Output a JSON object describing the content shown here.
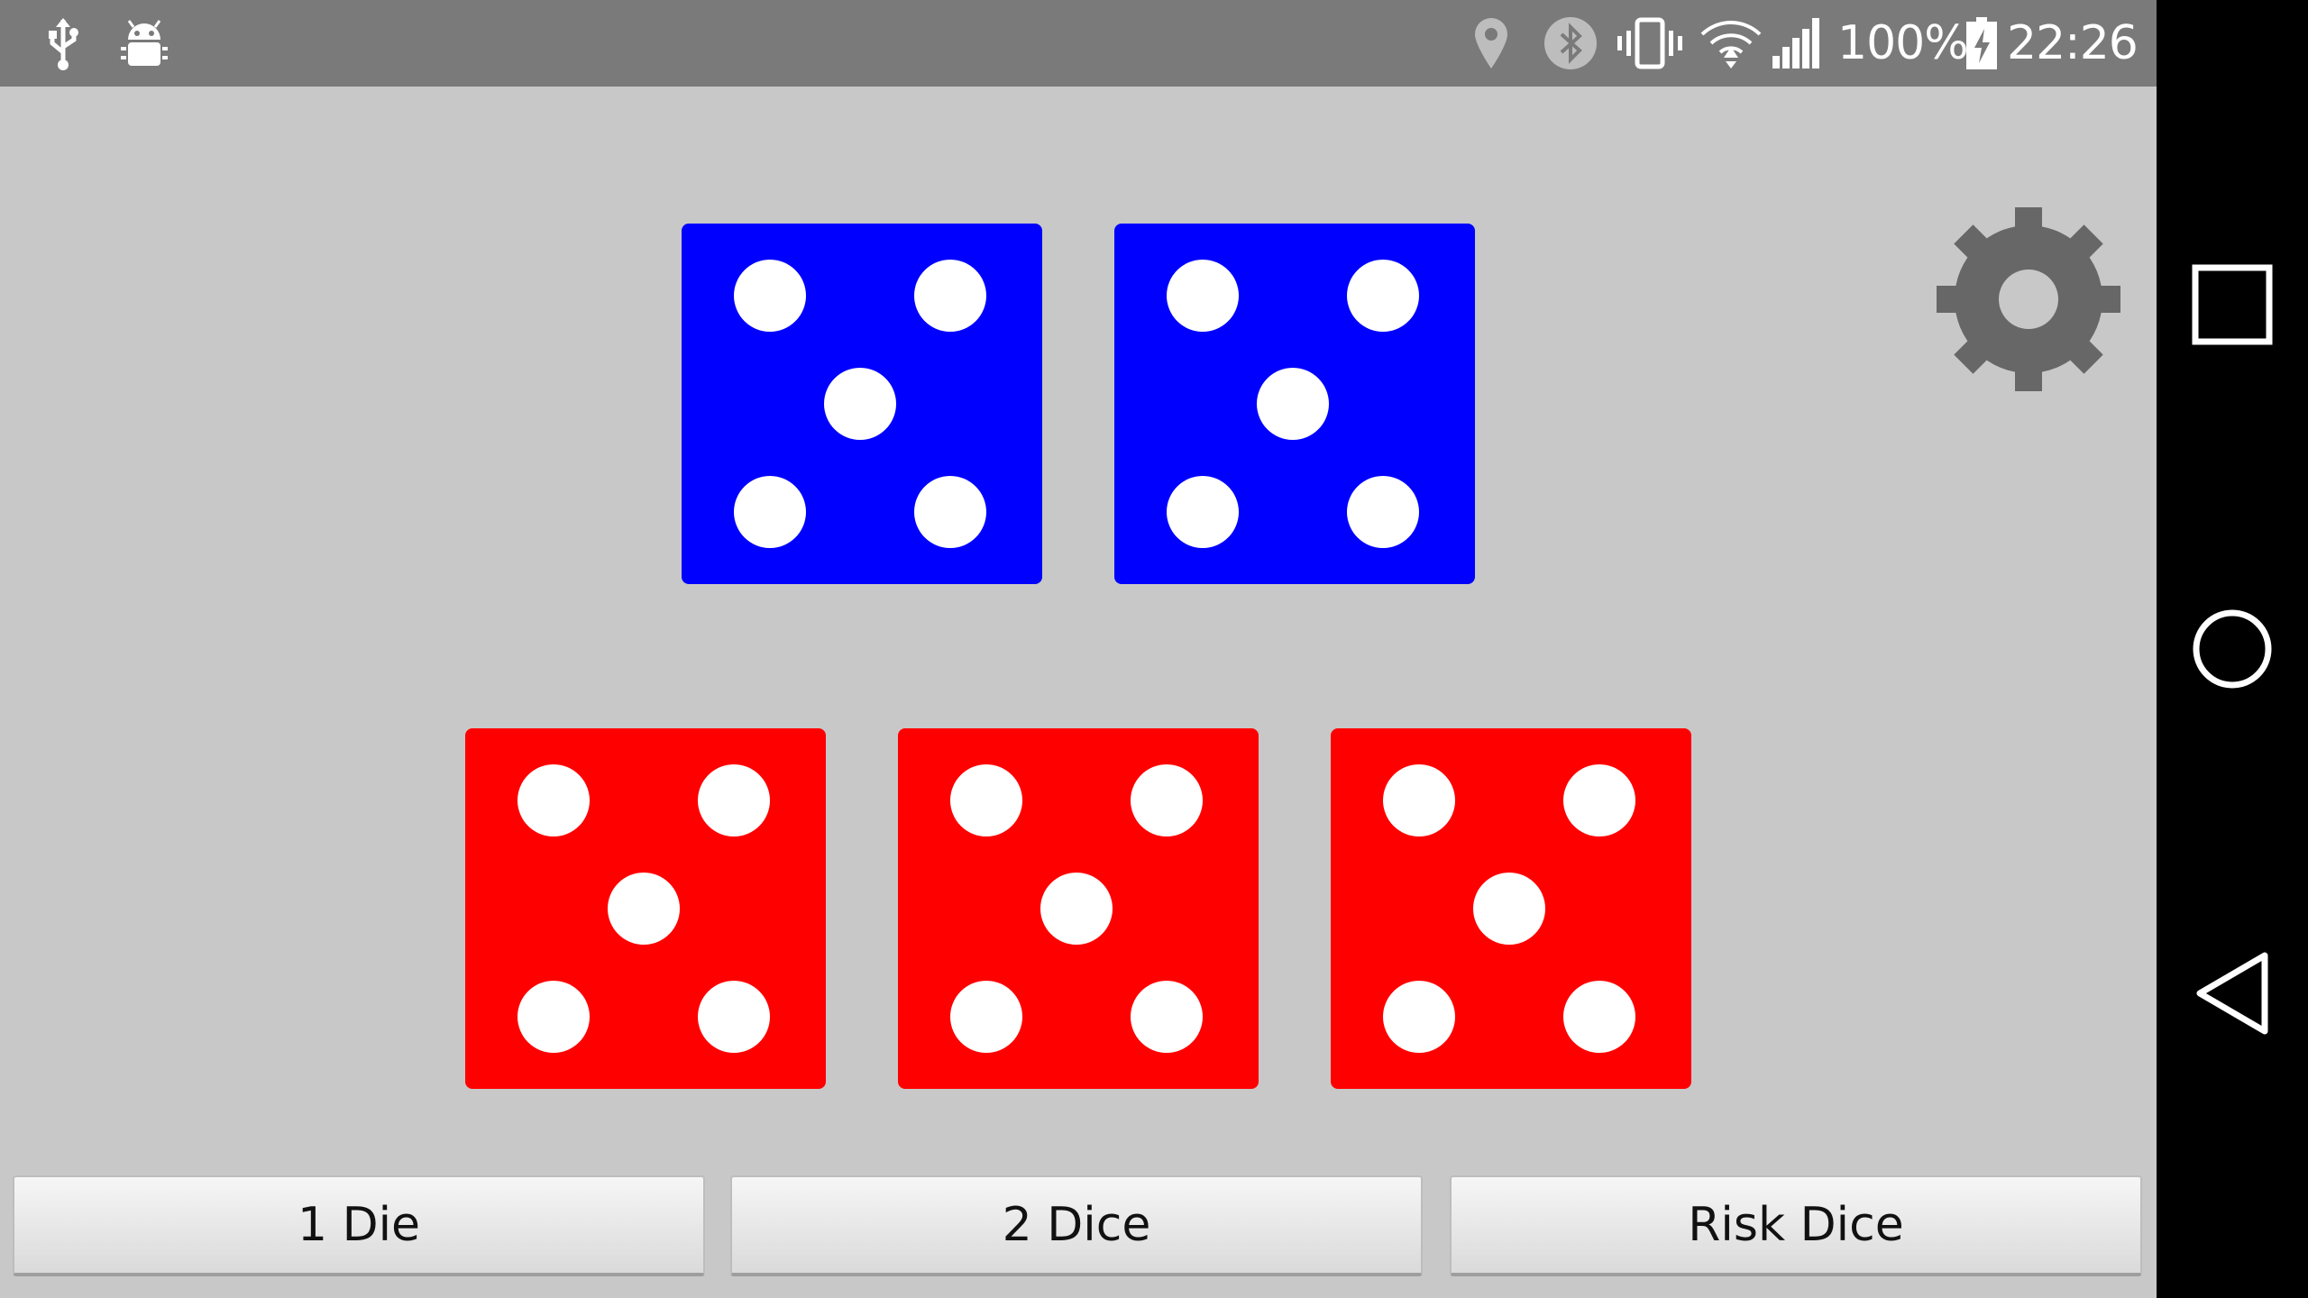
{
  "status_bar": {
    "battery_percent": "100%",
    "time": "22:26",
    "icons": [
      "usb-icon",
      "android-debug-icon",
      "location-icon",
      "bluetooth-icon",
      "vibrate-icon",
      "wifi-icon",
      "signal-icon",
      "battery-charging-icon"
    ]
  },
  "app": {
    "settings_icon": "gear-icon",
    "blue_dice": [
      {
        "value": 5,
        "color": "#0000ff"
      },
      {
        "value": 5,
        "color": "#0000ff"
      }
    ],
    "red_dice": [
      {
        "value": 5,
        "color": "#ff0000"
      },
      {
        "value": 5,
        "color": "#ff0000"
      },
      {
        "value": 5,
        "color": "#ff0000"
      }
    ],
    "buttons": {
      "one_die": "1 Die",
      "two_dice": "2 Dice",
      "risk_dice": "Risk Dice"
    }
  },
  "nav_bar": {
    "icons": [
      "recents-icon",
      "home-icon",
      "back-icon"
    ]
  },
  "colors": {
    "status_bar": "#7a7a7a",
    "background": "#c8c8c8",
    "gear": "#676767",
    "blue_die": "#0000ff",
    "red_die": "#ff0000"
  }
}
